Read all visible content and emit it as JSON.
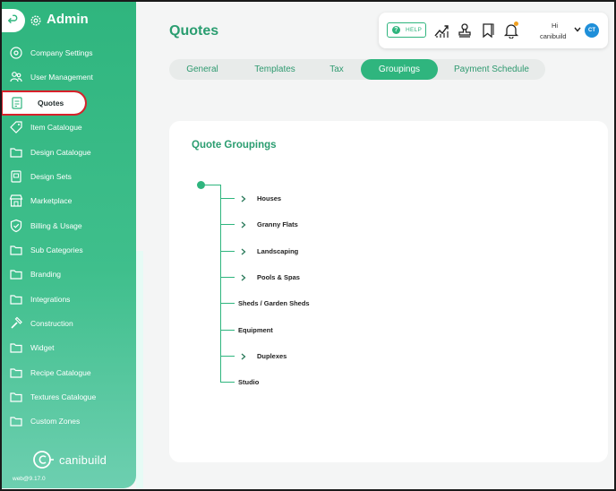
{
  "sidebar": {
    "title": "Admin",
    "items": [
      {
        "label": "Company Settings",
        "icon": "settings-circle-icon"
      },
      {
        "label": "User Management",
        "icon": "users-icon"
      },
      {
        "label": "Quotes",
        "icon": "quote-document-icon",
        "active": true
      },
      {
        "label": "Item Catalogue",
        "icon": "tag-icon"
      },
      {
        "label": "Design Catalogue",
        "icon": "folder-icon"
      },
      {
        "label": "Design Sets",
        "icon": "design-set-icon"
      },
      {
        "label": "Marketplace",
        "icon": "store-icon"
      },
      {
        "label": "Billing & Usage",
        "icon": "shield-check-icon"
      },
      {
        "label": "Sub Categories",
        "icon": "folder-icon"
      },
      {
        "label": "Branding",
        "icon": "folder-icon"
      },
      {
        "label": "Integrations",
        "icon": "folder-icon"
      },
      {
        "label": "Construction",
        "icon": "hammer-icon"
      },
      {
        "label": "Widget",
        "icon": "folder-icon"
      },
      {
        "label": "Recipe Catalogue",
        "icon": "folder-icon"
      },
      {
        "label": "Textures Catalogue",
        "icon": "folder-icon"
      },
      {
        "label": "Custom Zones",
        "icon": "folder-icon"
      }
    ],
    "brand": "canibuild",
    "version": "web@9.17.0"
  },
  "header": {
    "page_title": "Quotes",
    "help_label": "HELP",
    "greeting": "Hi",
    "username": "canibuild",
    "avatar_initials": "CT"
  },
  "tabs": [
    {
      "label": "General",
      "active": false
    },
    {
      "label": "Templates",
      "active": false
    },
    {
      "label": "Tax",
      "active": false
    },
    {
      "label": "Groupings",
      "active": true
    },
    {
      "label": "Payment Schedule",
      "active": false
    }
  ],
  "groupings": {
    "title": "Quote Groupings",
    "items": [
      {
        "label": "Houses",
        "expandable": true
      },
      {
        "label": "Granny Flats",
        "expandable": true
      },
      {
        "label": "Landscaping",
        "expandable": true
      },
      {
        "label": "Pools & Spas",
        "expandable": true
      },
      {
        "label": "Sheds / Garden Sheds",
        "expandable": false
      },
      {
        "label": "Equipment",
        "expandable": false
      },
      {
        "label": "Duplexes",
        "expandable": true
      },
      {
        "label": "Studio",
        "expandable": false
      }
    ]
  },
  "colors": {
    "accent": "#2fb57e",
    "title_green": "#2a9d70",
    "highlight_border": "#d8202a",
    "avatar": "#1f8fd9",
    "notification_dot": "#f0a020"
  }
}
